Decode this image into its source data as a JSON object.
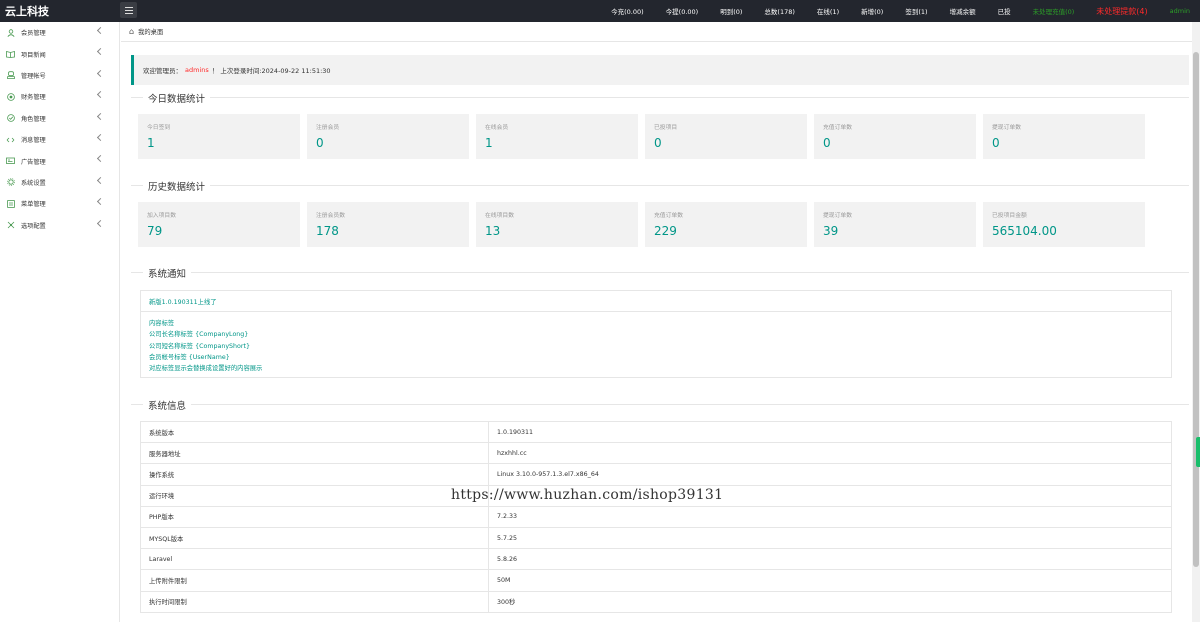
{
  "brand": "云上科技",
  "topnav": [
    {
      "label": "今充(0.00)",
      "tone": "normal"
    },
    {
      "label": "今提(0.00)",
      "tone": "normal"
    },
    {
      "label": "明到(0)",
      "tone": "normal"
    },
    {
      "label": "总数(178)",
      "tone": "normal"
    },
    {
      "label": "在线(1)",
      "tone": "normal"
    },
    {
      "label": "新增(0)",
      "tone": "normal"
    },
    {
      "label": "签到(1)",
      "tone": "normal"
    },
    {
      "label": "增减余额",
      "tone": "normal"
    },
    {
      "label": "已投",
      "tone": "normal"
    },
    {
      "label": "未处理充值(0)",
      "tone": "green"
    },
    {
      "label": "未处理提款(4)",
      "tone": "red"
    },
    {
      "label": "admin",
      "tone": "admin"
    }
  ],
  "sidebar": [
    {
      "label": "会员管理",
      "icon": "user-icon"
    },
    {
      "label": "项目新闻",
      "icon": "book-icon"
    },
    {
      "label": "管理帐号",
      "icon": "account-icon"
    },
    {
      "label": "财务管理",
      "icon": "finance-icon"
    },
    {
      "label": "角色管理",
      "icon": "shield-icon"
    },
    {
      "label": "消息管理",
      "icon": "message-icon"
    },
    {
      "label": "广告管理",
      "icon": "ad-icon"
    },
    {
      "label": "系统设置",
      "icon": "gear-icon"
    },
    {
      "label": "菜单管理",
      "icon": "menu-icon"
    },
    {
      "label": "选项配置",
      "icon": "option-icon"
    }
  ],
  "breadcrumb": "我的桌面",
  "welcome": {
    "prefix": "欢迎管理员：",
    "name": "admins",
    "suffix": "！ 上次登录时间:2024-09-22 11:51:30"
  },
  "today": {
    "title": "今日数据统计",
    "cards": [
      {
        "label": "今日签到",
        "value": "1"
      },
      {
        "label": "注册会员",
        "value": "0"
      },
      {
        "label": "在线会员",
        "value": "1"
      },
      {
        "label": "已投项目",
        "value": "0"
      },
      {
        "label": "充值订单数",
        "value": "0"
      },
      {
        "label": "提现订单数",
        "value": "0"
      }
    ]
  },
  "history": {
    "title": "历史数据统计",
    "cards": [
      {
        "label": "加入项目数",
        "value": "79"
      },
      {
        "label": "注册会员数",
        "value": "178"
      },
      {
        "label": "在线项目数",
        "value": "13"
      },
      {
        "label": "充值订单数",
        "value": "229"
      },
      {
        "label": "提现订单数",
        "value": "39"
      },
      {
        "label": "已投项目金额",
        "value": "565104.00"
      }
    ]
  },
  "notice": {
    "title": "系统通知",
    "headline": "新版1.0.190311上线了",
    "lines": [
      "内容标签",
      "公司长名称标签 {CompanyLong}",
      "公司短名称标签 {CompanyShort}",
      "会员帐号标签 {UserName}",
      "对应标签显示会替换成设置好的内容展示"
    ]
  },
  "sysinfo": {
    "title": "系统信息",
    "rows": [
      {
        "key": "系统版本",
        "value": "1.0.190311"
      },
      {
        "key": "服务器地址",
        "value": "hzxhhl.cc"
      },
      {
        "key": "操作系统",
        "value": "Linux 3.10.0-957.1.3.el7.x86_64"
      },
      {
        "key": "运行环境",
        "value": ""
      },
      {
        "key": "PHP版本",
        "value": "7.2.33"
      },
      {
        "key": "MYSQL版本",
        "value": "5.7.25"
      },
      {
        "key": "Laravel",
        "value": "5.8.26"
      },
      {
        "key": "上传附件限制",
        "value": "50M"
      },
      {
        "key": "执行时间限制",
        "value": "300秒"
      }
    ]
  },
  "watermark": "https://www.huzhan.com/ishop39131",
  "colors": {
    "accent": "#009688",
    "topbar": "#23262e",
    "alert": "#ff2a2a",
    "ok": "#2c9f28"
  }
}
